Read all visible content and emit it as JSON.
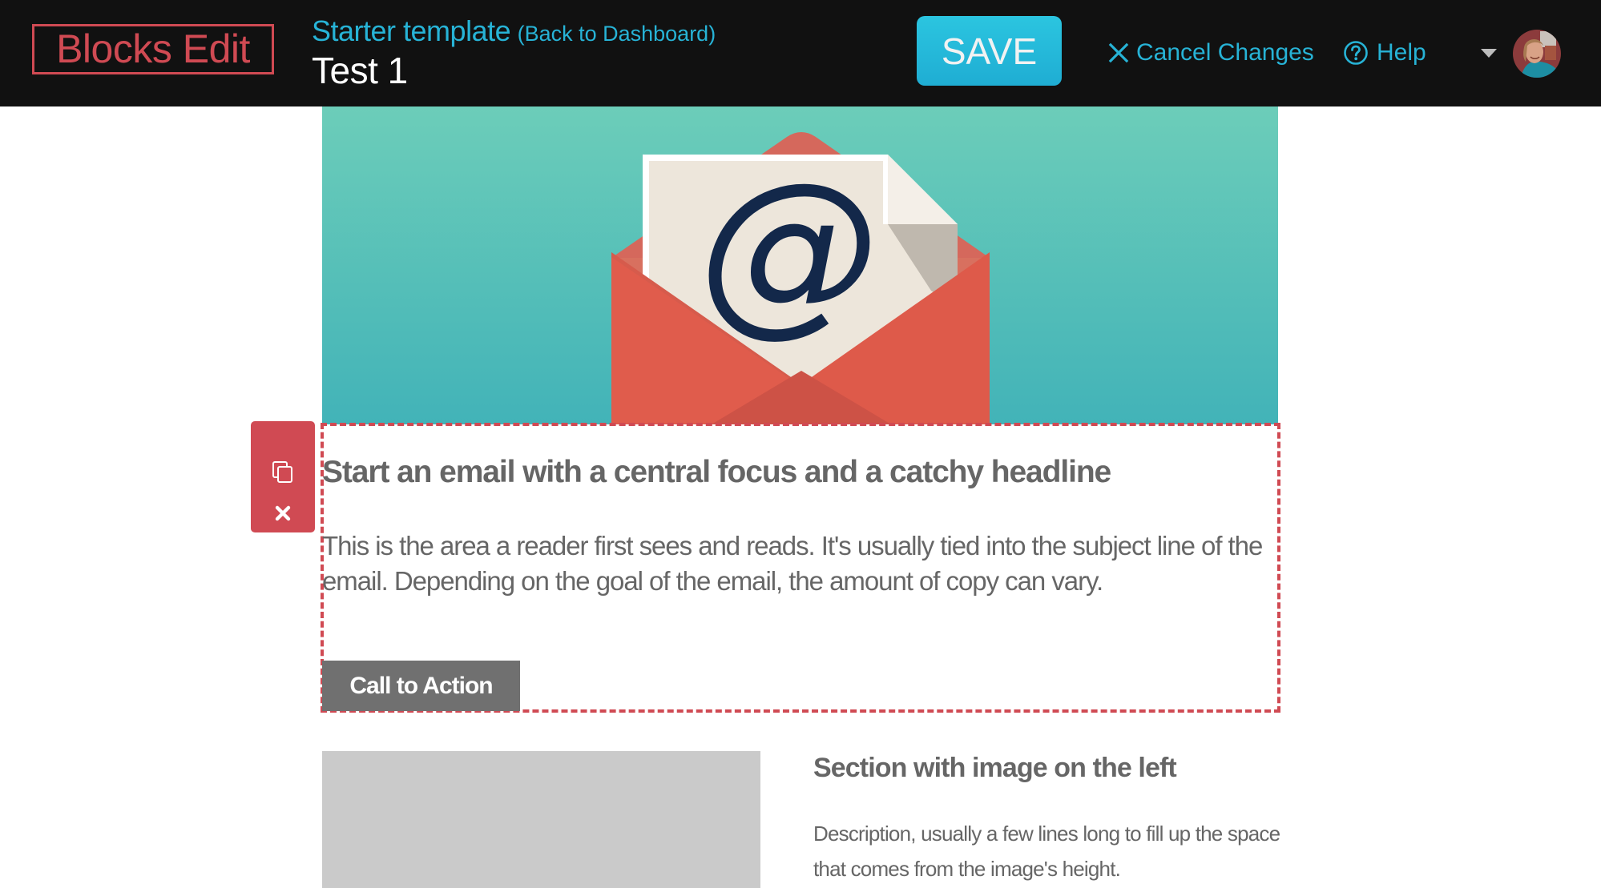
{
  "header": {
    "logo": "Blocks Edit",
    "template_name": "Starter template",
    "back_link": "(Back to Dashboard)",
    "document_title": "Test 1",
    "save_label": "SAVE",
    "cancel_label": "Cancel Changes",
    "help_label": "Help",
    "icons": {
      "cancel": "close-icon",
      "help": "question-circle-icon",
      "user_menu": "caret-down-icon",
      "avatar": "user-avatar"
    }
  },
  "colors": {
    "header_bg": "#111111",
    "brand_red": "#d04a53",
    "accent_blue": "#27b3d6",
    "text_gray": "#666666",
    "cta_gray": "#707070",
    "placeholder_gray": "#cacaca",
    "hero_top": "#6ccdb9",
    "hero_bottom": "#42b3b8",
    "envelope_red": "#e05c4c",
    "paper": "#ede6db",
    "at_sign": "#13284a"
  },
  "email": {
    "hero": {
      "alt": "envelope-with-at-sign-illustration",
      "glyph": "@"
    },
    "selected_block": {
      "tools": {
        "duplicate": "duplicate-icon",
        "delete": "delete-icon"
      },
      "headline": "Start an email with a central focus and a catchy headline",
      "body": "This is the area a reader first sees and reads. It's usually tied into the subject line of the email. Depending on the goal of the email, the amount of copy can vary.",
      "cta_label": "Call to Action"
    },
    "image_left_section": {
      "heading": "Section with image on the left",
      "description": "Description, usually a few lines long to fill up the space that comes from the image's height."
    }
  }
}
